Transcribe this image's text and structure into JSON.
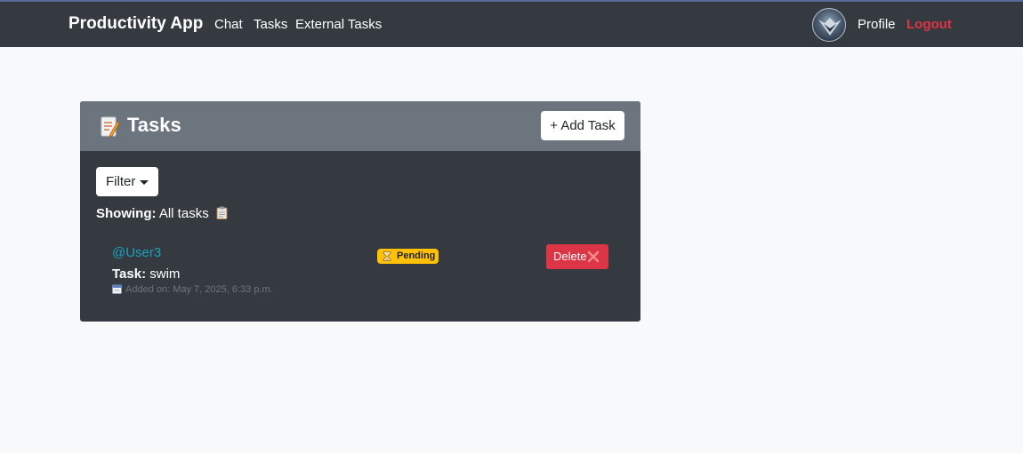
{
  "navbar": {
    "brand": "Productivity App",
    "links": [
      "Chat",
      "Tasks",
      "External Tasks"
    ],
    "profile_label": "Profile",
    "logout_label": "Logout"
  },
  "tasks_card": {
    "title": "Tasks",
    "add_button_label": "+ Add Task",
    "filter_label": "Filter",
    "showing_label": "Showing:",
    "showing_value": "All tasks",
    "items": [
      {
        "user": "@User3",
        "task_label": "Task:",
        "task_name": "swim",
        "added": "Added on: May 7, 2025, 6:33 p.m.",
        "status": "Pending",
        "delete_label": "Delete"
      }
    ]
  },
  "colors": {
    "navbar": "#343a40",
    "header": "#6c757d",
    "card_body": "#343a40",
    "user_link": "#17a2b8",
    "badge_pending": "#ffc107",
    "delete": "#dc3545",
    "logout": "#e03444"
  },
  "icons": [
    "memo-icon",
    "clipboard-icon",
    "calendar-icon",
    "hourglass-icon",
    "cross-mark-icon",
    "caret-down-icon",
    "avatar"
  ]
}
